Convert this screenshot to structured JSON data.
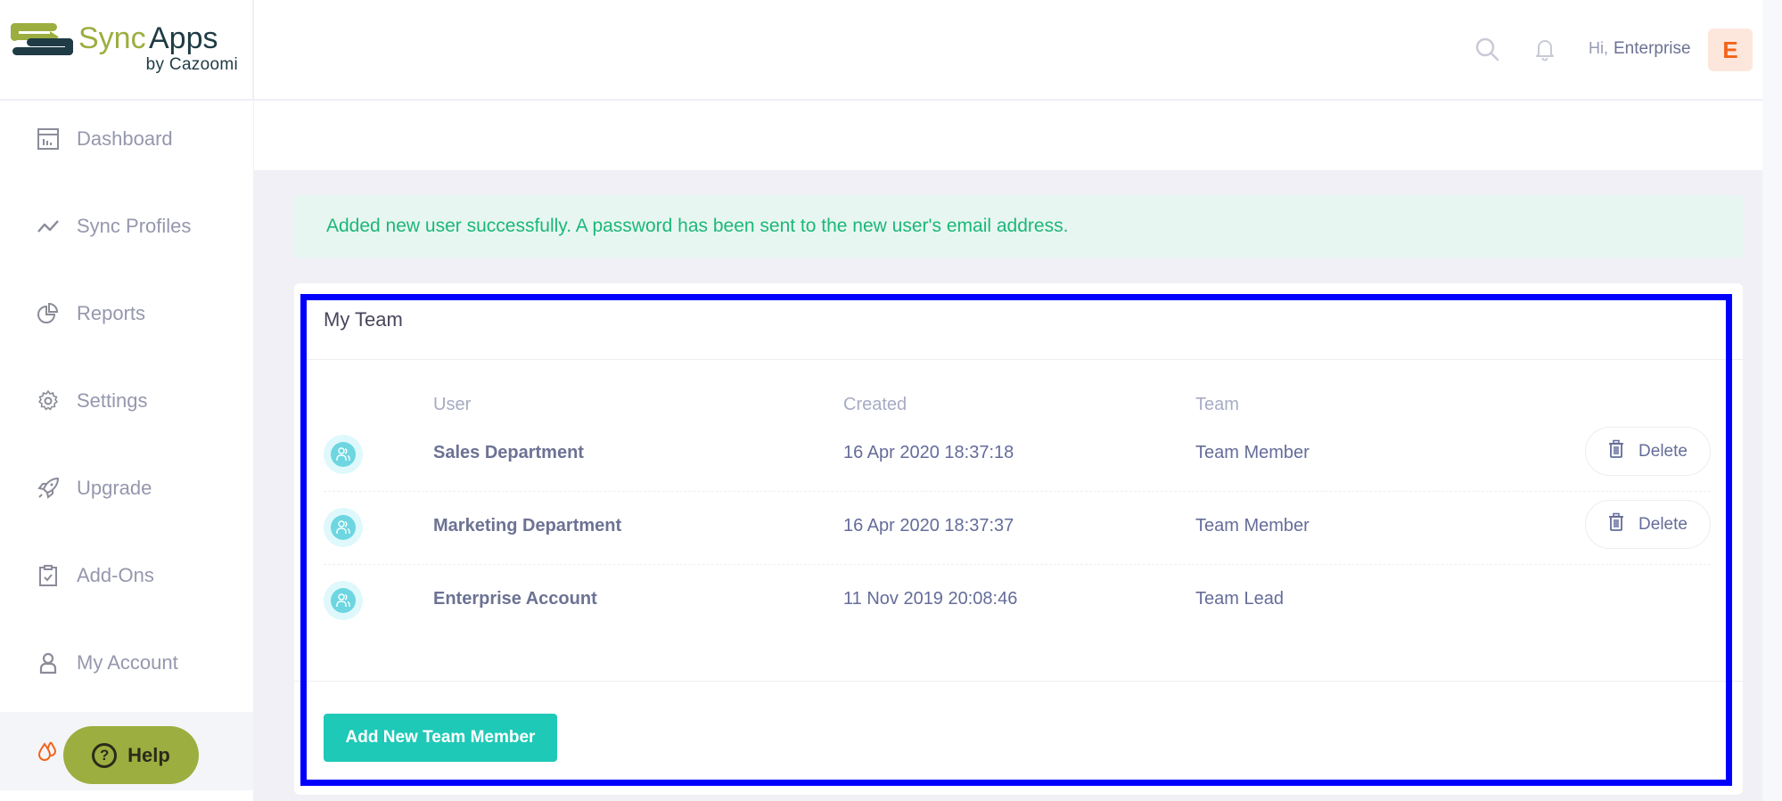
{
  "brand": {
    "name_part1": "Sync",
    "name_part2": "Apps",
    "byline": "by Cazoomi",
    "colors": {
      "green": "#9cae40",
      "dark": "#1f3b45"
    }
  },
  "topbar": {
    "search_icon": "search-icon",
    "notifications_icon": "bell-icon",
    "greeting": "Hi,",
    "user_name": "Enterprise",
    "avatar_letter": "E"
  },
  "sidebar": {
    "items": [
      {
        "label": "Dashboard",
        "icon": "dashboard-icon"
      },
      {
        "label": "Sync Profiles",
        "icon": "line-chart-icon"
      },
      {
        "label": "Reports",
        "icon": "pie-chart-icon"
      },
      {
        "label": "Settings",
        "icon": "gear-icon"
      },
      {
        "label": "Upgrade",
        "icon": "rocket-icon"
      },
      {
        "label": "Add-Ons",
        "icon": "clipboard-check-icon"
      },
      {
        "label": "My Account",
        "icon": "user-icon"
      },
      {
        "label": "",
        "icon": "drops-icon",
        "active": true
      }
    ],
    "help_label": "Help"
  },
  "alert": {
    "message": "Added new user successfully. A password has been sent to the new user's email address.",
    "color": "#1bb77a"
  },
  "team_card": {
    "title": "My Team",
    "columns": [
      "User",
      "Created",
      "Team"
    ],
    "rows": [
      {
        "user": "Sales Department",
        "created": "16 Apr 2020 18:37:18",
        "team": "Team Member",
        "delete_label": "Delete"
      },
      {
        "user": "Marketing Department",
        "created": "16 Apr 2020 18:37:37",
        "team": "Team Member",
        "delete_label": "Delete"
      },
      {
        "user": "Enterprise Account",
        "created": "11 Nov 2019 20:08:46",
        "team": "Team Lead"
      }
    ],
    "add_button_label": "Add New Team Member",
    "accent": "#1ec9b7"
  }
}
